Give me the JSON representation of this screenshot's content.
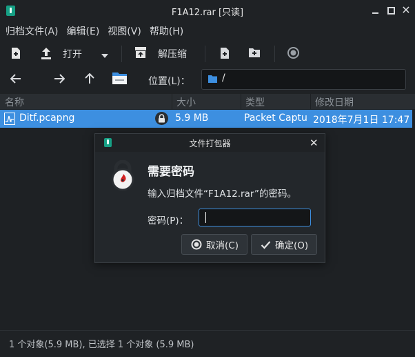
{
  "window": {
    "title": "F1A12.rar [只读]"
  },
  "menu": [
    "归档文件(A)",
    "编辑(E)",
    "视图(V)",
    "帮助(H)"
  ],
  "toolbar": {
    "open_label": "打开",
    "extract_label": "解压缩"
  },
  "location": {
    "label": "位置(L)：",
    "path": "/"
  },
  "columns": {
    "name": "名称",
    "size": "大小",
    "type": "类型",
    "modified": "修改日期"
  },
  "files": [
    {
      "name": "Ditf.pcapng",
      "size": "5.9 MB",
      "type": "Packet Capture",
      "modified": "2018年7月1日 17:47"
    }
  ],
  "status": {
    "text": "1 个对象(5.9 MB), 已选择 1 个对象 (5.9 MB)"
  },
  "dialog": {
    "title": "文件打包器",
    "heading": "需要密码",
    "message": "输入归档文件“F1A12.rar”的密码。",
    "password_label": "密码(P)：",
    "password_value": "",
    "cancel_label": "取消(C)",
    "ok_label": "确定(O)"
  },
  "colors": {
    "accent": "#3d8fe0",
    "app_icon": "#16a085",
    "background": "#1e2124"
  }
}
